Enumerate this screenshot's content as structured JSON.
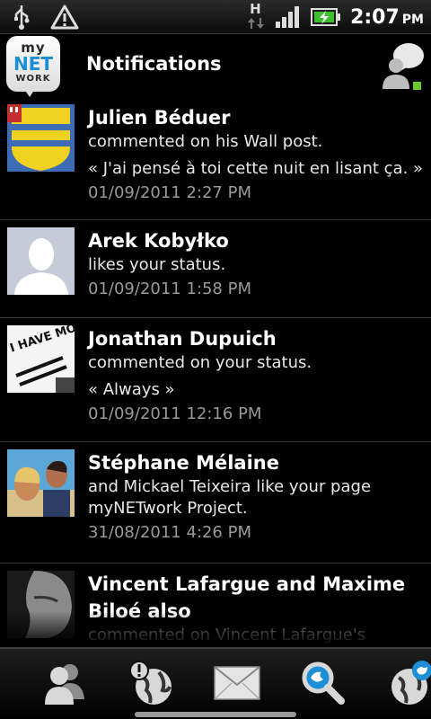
{
  "status_bar": {
    "time": "2:07",
    "ampm": "PM",
    "network_label": "H",
    "icons": [
      "usb-icon",
      "warning-icon",
      "signal-icon",
      "battery-charging-icon"
    ]
  },
  "header": {
    "logo": {
      "my": "my",
      "net": "NET",
      "work": "WORK"
    },
    "title": "Notifications",
    "chat_icon": "chat-bubble-icon"
  },
  "notifications": [
    {
      "name": "Julien Béduer",
      "lines": [
        "commented on his Wall post.",
        "« J'ai pensé à toi cette nuit en lisant ça. »"
      ],
      "date": "01/09/2011 2:27 PM",
      "avatar": "coat-of-arms"
    },
    {
      "name": "Arek Kobyłko",
      "lines": [
        "likes your status."
      ],
      "date": "01/09/2011 1:58 PM",
      "avatar": "default-silhouette"
    },
    {
      "name": "Jonathan Dupuich",
      "lines": [
        "commented on your status.",
        "« Always »"
      ],
      "date": "01/09/2011 12:16 PM",
      "avatar": "i-have-moved"
    },
    {
      "name": "Stéphane Mélaine",
      "lines": [
        "and Mickael Teixeira like your page",
        "myNETwork Project."
      ],
      "date": "31/08/2011 4:26 PM",
      "avatar": "photo-couple"
    },
    {
      "name": "Vincent Lafargue and Maxime Biloé also",
      "lines": [
        "commented on Vincent Lafargue's"
      ],
      "date": "",
      "avatar": "photo-man"
    }
  ],
  "avatar_text": {
    "i_have_moved": "I HAVE MOVED"
  },
  "bottom_nav": [
    "friends-icon",
    "globe-alert-icon",
    "mail-icon",
    "search-icon",
    "globe-twitter-icon"
  ],
  "colors": {
    "accent": "#1a8fd6",
    "date": "#9a9a9a",
    "background": "#000000"
  }
}
